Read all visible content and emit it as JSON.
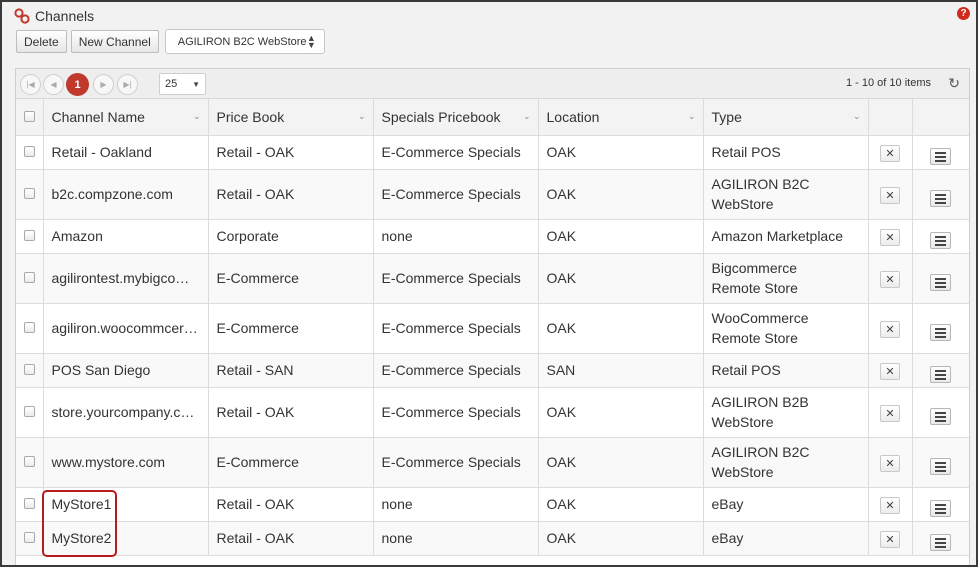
{
  "window": {
    "title": "Channels"
  },
  "toolbar": {
    "delete_label": "Delete",
    "new_channel_label": "New Channel",
    "store_select_value": "AGILIRON B2C WebStore"
  },
  "pager": {
    "current_page": "1",
    "page_size": "25",
    "info": "1 - 10 of 10 items"
  },
  "columns": [
    "Channel Name",
    "Price Book",
    "Specials Pricebook",
    "Location",
    "Type"
  ],
  "rows": [
    {
      "name": "Retail - Oakland",
      "price_book": "Retail - OAK",
      "specials": "E-Commerce Specials",
      "location": "OAK",
      "type": "Retail POS"
    },
    {
      "name": "b2c.compzone.com",
      "price_book": "Retail - OAK",
      "specials": "E-Commerce Specials",
      "location": "OAK",
      "type": "AGILIRON B2C WebStore"
    },
    {
      "name": "Amazon",
      "price_book": "Corporate",
      "specials": "none",
      "location": "OAK",
      "type": "Amazon Marketplace"
    },
    {
      "name": "agilirontest.mybigcomm...",
      "price_book": "E-Commerce",
      "specials": "E-Commerce Specials",
      "location": "OAK",
      "type": "Bigcommerce Remote Store"
    },
    {
      "name": "agiliron.woocommcerce...",
      "price_book": "E-Commerce",
      "specials": "E-Commerce Specials",
      "location": "OAK",
      "type": "WooCommerce Remote Store"
    },
    {
      "name": "POS San Diego",
      "price_book": "Retail - SAN",
      "specials": "E-Commerce Specials",
      "location": "SAN",
      "type": "Retail POS"
    },
    {
      "name": "store.yourcompany.com",
      "price_book": "Retail - OAK",
      "specials": "E-Commerce Specials",
      "location": "OAK",
      "type": "AGILIRON B2B WebStore"
    },
    {
      "name": "www.mystore.com",
      "price_book": "E-Commerce",
      "specials": "E-Commerce Specials",
      "location": "OAK",
      "type": "AGILIRON B2C WebStore"
    },
    {
      "name": "MyStore1",
      "price_book": "Retail - OAK",
      "specials": "none",
      "location": "OAK",
      "type": "eBay"
    },
    {
      "name": "MyStore2",
      "price_book": "Retail - OAK",
      "specials": "none",
      "location": "OAK",
      "type": "eBay"
    }
  ],
  "icons": {
    "title": "link-icon",
    "help": "help-icon",
    "delete_row": "close-icon",
    "row_menu": "hamburger-menu-icon",
    "refresh": "refresh-icon"
  },
  "colors": {
    "accent": "#c0392b",
    "highlight": "#b71c1c"
  }
}
